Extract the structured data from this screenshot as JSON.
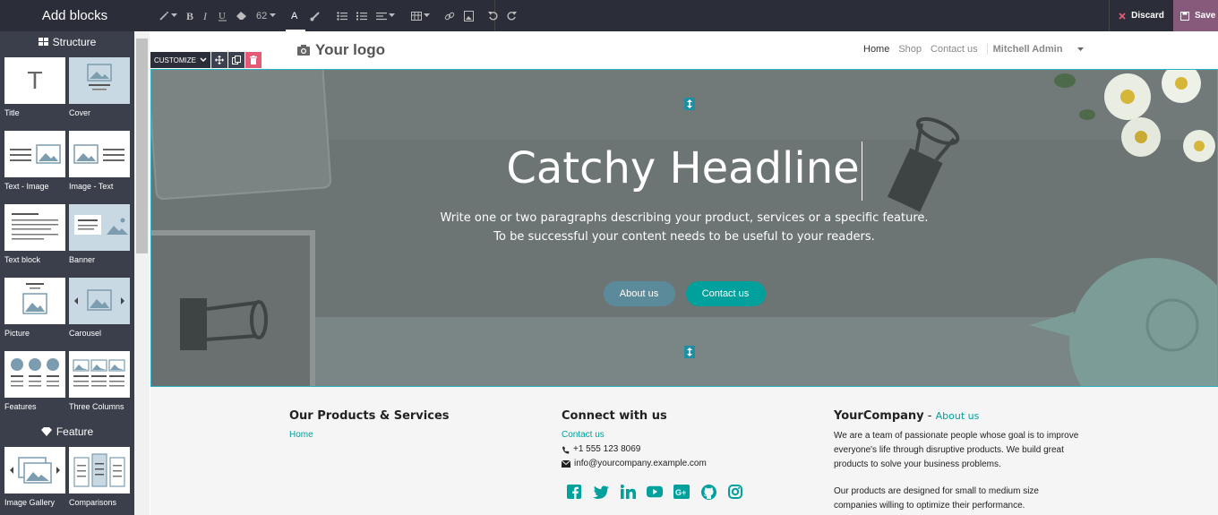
{
  "sidebar": {
    "title": "Add blocks",
    "sections": [
      {
        "title": "Structure",
        "icon": "grid-icon",
        "blocks": [
          "Title",
          "Cover",
          "Text - Image",
          "Image - Text",
          "Text block",
          "Banner",
          "Picture",
          "Carousel",
          "Features",
          "Three Columns"
        ]
      },
      {
        "title": "Feature",
        "icon": "diamond-icon",
        "blocks": [
          "Image Gallery",
          "Comparisons"
        ]
      }
    ]
  },
  "toolbar": {
    "font_size": "62",
    "discard_label": "Discard",
    "save_label": "Save"
  },
  "site": {
    "logo_text": "Your logo",
    "nav": [
      "Home",
      "Shop",
      "Contact us"
    ],
    "user": "Mitchell Admin"
  },
  "customize": {
    "label": "CUSTOMIZE"
  },
  "hero": {
    "headline": "Catchy Headline",
    "line1": "Write one or two paragraphs describing your product, services or a specific feature.",
    "line2": "To be successful your content needs to be useful to your readers.",
    "btn_about": "About us",
    "btn_contact": "Contact us"
  },
  "footer": {
    "col1": {
      "title": "Our Products & Services",
      "link": "Home"
    },
    "col2": {
      "title": "Connect with us",
      "link": "Contact us",
      "phone": "+1 555 123 8069",
      "email": "info@yourcompany.example.com"
    },
    "col3": {
      "title": "YourCompany",
      "sep": " - ",
      "link": "About us",
      "p1": "We are a team of passionate people whose goal is to improve everyone's life through disruptive products. We build great products to solve your business problems.",
      "p2": "Our products are designed for small to medium size companies willing to optimize their performance."
    }
  },
  "colors": {
    "accent": "#00a09d",
    "brand": "#875a7b",
    "dark": "#2b2e38",
    "sidebar": "#3a3f4b",
    "danger": "#e25a75"
  }
}
